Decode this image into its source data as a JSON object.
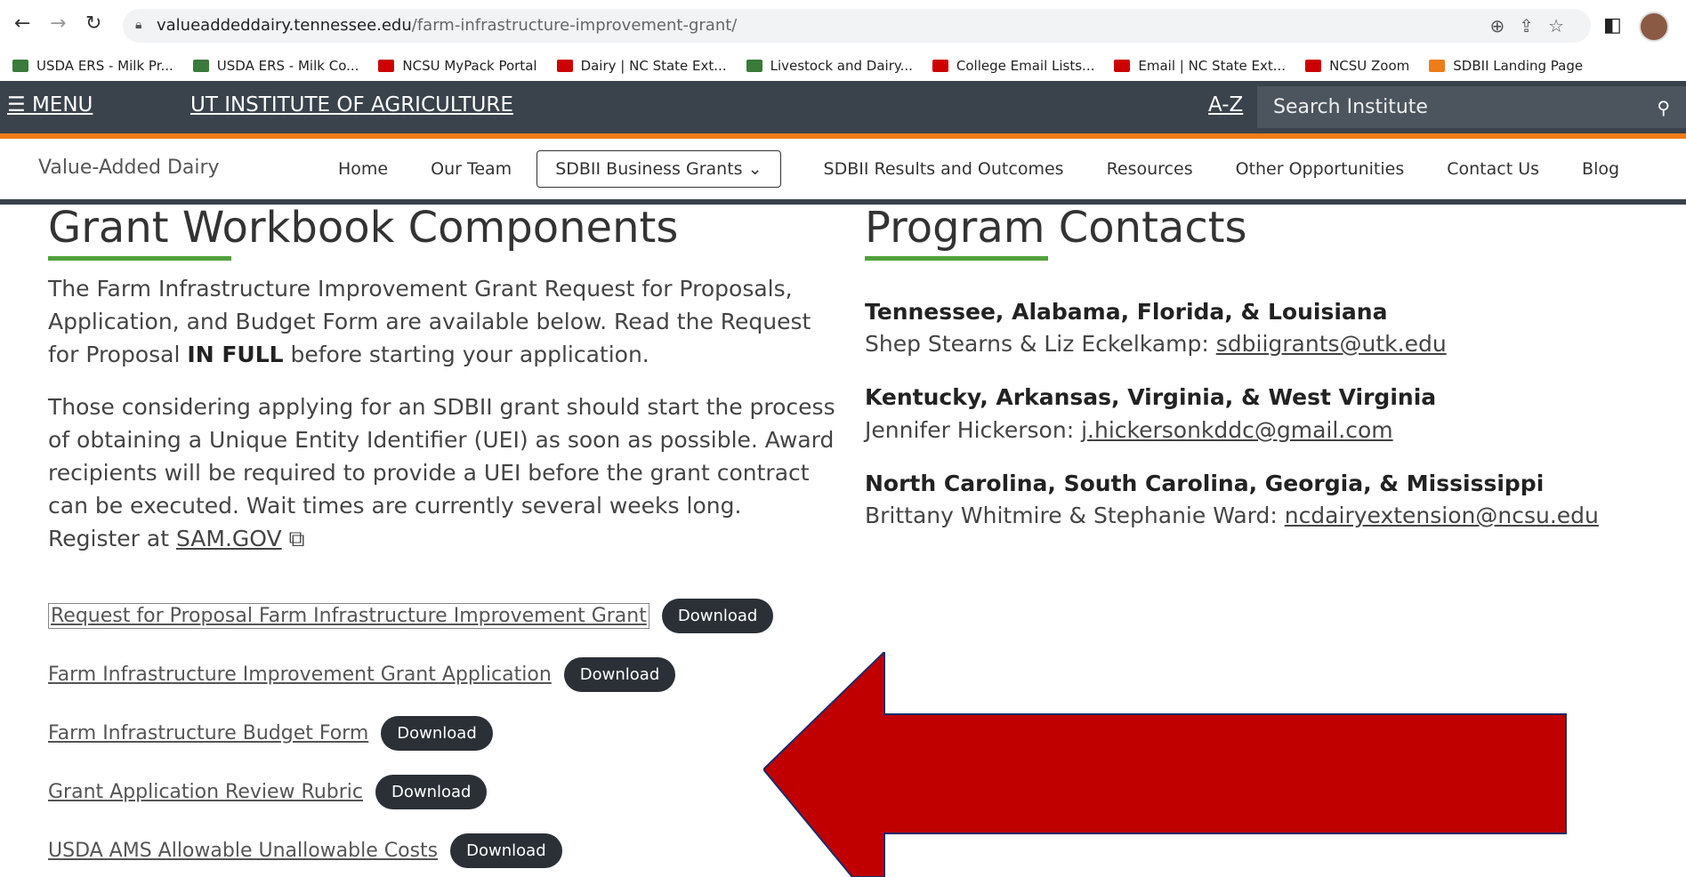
{
  "browser": {
    "url_host": "valueaddeddairy.tennessee.edu",
    "url_path": "/farm-infrastructure-improvement-grant/",
    "bookmarks": [
      {
        "label": "USDA ERS - Milk Pr...",
        "color": "#3a7a3a"
      },
      {
        "label": "USDA ERS - Milk Co...",
        "color": "#3a7a3a"
      },
      {
        "label": "NCSU MyPack Portal",
        "color": "#cc0000"
      },
      {
        "label": "Dairy | NC State Ext...",
        "color": "#cc0000"
      },
      {
        "label": "Livestock and Dairy...",
        "color": "#3a7a3a"
      },
      {
        "label": "College Email Lists...",
        "color": "#cc0000"
      },
      {
        "label": "Email | NC State Ext...",
        "color": "#cc0000"
      },
      {
        "label": "NCSU Zoom",
        "color": "#cc0000"
      },
      {
        "label": "SDBII Landing Page",
        "color": "#ee7c1a"
      }
    ]
  },
  "topbar": {
    "menu_label": "MENU",
    "institute": "UT INSTITUTE OF AGRICULTURE",
    "az": "A-Z",
    "search_placeholder": "Search Institute"
  },
  "sitenav": {
    "site_title": "Value-Added Dairy",
    "links": [
      "Home",
      "Our Team",
      "SDBII Business Grants",
      "SDBII Results and Outcomes",
      "Resources",
      "Other Opportunities",
      "Contact Us",
      "Blog"
    ]
  },
  "left": {
    "heading": "Grant Workbook Components",
    "para1_a": "The Farm Infrastructure Improvement Grant Request for Proposals, Application, and Budget Form are available below. Read the Request for Proposal ",
    "para1_bold": "IN FULL",
    "para1_b": " before starting your application.",
    "para2": "Those considering applying for an SDBII grant should start the process of obtaining a Unique Entity Identifier (UEI) as soon as possible. Award recipients will be required to provide a UEI before the grant contract can be executed. Wait times are currently several weeks long. Register at ",
    "para2_link": "SAM.GOV",
    "downloads": [
      {
        "label": "Request for Proposal Farm Infrastructure Improvement Grant",
        "button": "Download"
      },
      {
        "label": "Farm Infrastructure Improvement Grant Application",
        "button": "Download"
      },
      {
        "label": "Farm Infrastructure Budget Form",
        "button": "Download"
      },
      {
        "label": "Grant Application Review Rubric",
        "button": "Download"
      },
      {
        "label": "USDA AMS Allowable Unallowable Costs",
        "button": "Download"
      }
    ]
  },
  "right": {
    "heading": "Program Contacts",
    "contacts": [
      {
        "region": "Tennessee, Alabama, Florida, & Louisiana",
        "people": "Shep Stearns & Liz Eckelkamp: ",
        "email": "sdbiigrants@utk.edu"
      },
      {
        "region": "Kentucky, Arkansas, Virginia, & West Virginia",
        "people": "Jennifer Hickerson: ",
        "email": "j.hickersonkddc@gmail.com"
      },
      {
        "region": "North Carolina, South Carolina, Georgia, & Mississippi",
        "people": "Brittany Whitmire & Stephanie Ward: ",
        "email": "ncdairyextension@ncsu.edu"
      }
    ]
  },
  "annotation": {
    "arrow_color": "#c00000"
  }
}
